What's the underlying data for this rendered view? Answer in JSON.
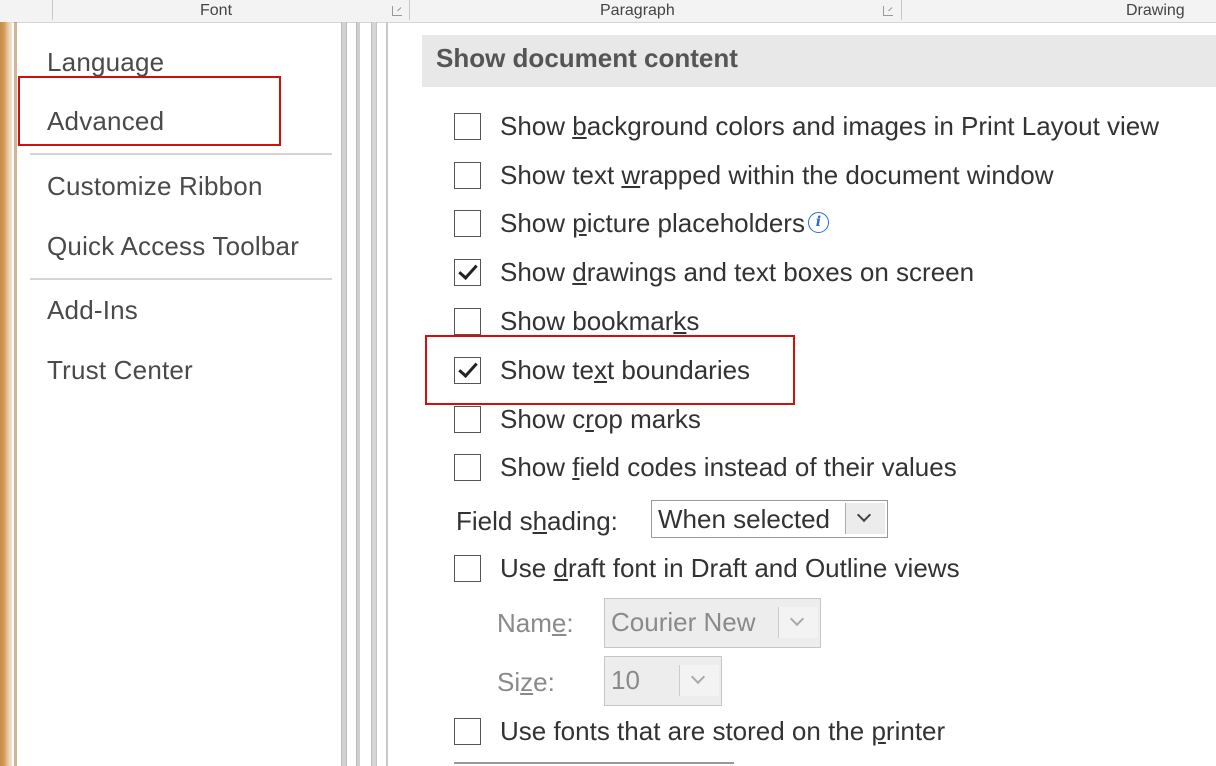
{
  "ribbon": {
    "groups": [
      "Font",
      "Paragraph",
      "Drawing"
    ]
  },
  "nav": {
    "items": [
      "Language",
      "Advanced",
      "Customize Ribbon",
      "Quick Access Toolbar",
      "Add-Ins",
      "Trust Center"
    ]
  },
  "section": {
    "title": "Show document content"
  },
  "options": [
    {
      "pre": "Show ",
      "u": "b",
      "post": "ackground colors and images in Print Layout view",
      "checked": false
    },
    {
      "pre": "Show text ",
      "u": "w",
      "post": "rapped within the document window",
      "checked": false
    },
    {
      "pre": "Show ",
      "u": "p",
      "post": "icture placeholders",
      "checked": false,
      "info_icon": "info-icon"
    },
    {
      "pre": "Show ",
      "u": "d",
      "post": "rawings and text boxes on screen",
      "checked": true
    },
    {
      "pre": "Show bookmar",
      "u": "k",
      "post": "s",
      "checked": false
    },
    {
      "pre": "Show te",
      "u": "x",
      "post": "t boundaries",
      "checked": true
    },
    {
      "pre": "Show c",
      "u": "r",
      "post": "op marks",
      "checked": false
    },
    {
      "pre": "Show ",
      "u": "f",
      "post": "ield codes instead of their values",
      "checked": false
    }
  ],
  "field_shading": {
    "pre": "Field s",
    "u": "h",
    "post": "ading:",
    "value": "When selected"
  },
  "draft": {
    "option": {
      "pre": "Use ",
      "u": "d",
      "post": "raft font in Draft and Outline views",
      "checked": false
    },
    "name_label": {
      "pre": "Nam",
      "u": "e",
      "post": ":"
    },
    "name_value": "Courier New",
    "size_label": {
      "pre": "Si",
      "u": "z",
      "post": "e:"
    },
    "size_value": "10"
  },
  "printer_fonts": {
    "pre": "Use fonts that are stored on the ",
    "u": "p",
    "post": "rinter",
    "checked": false
  },
  "colors": {
    "highlight": "#d01010",
    "accent_edge": "#c58b47"
  }
}
